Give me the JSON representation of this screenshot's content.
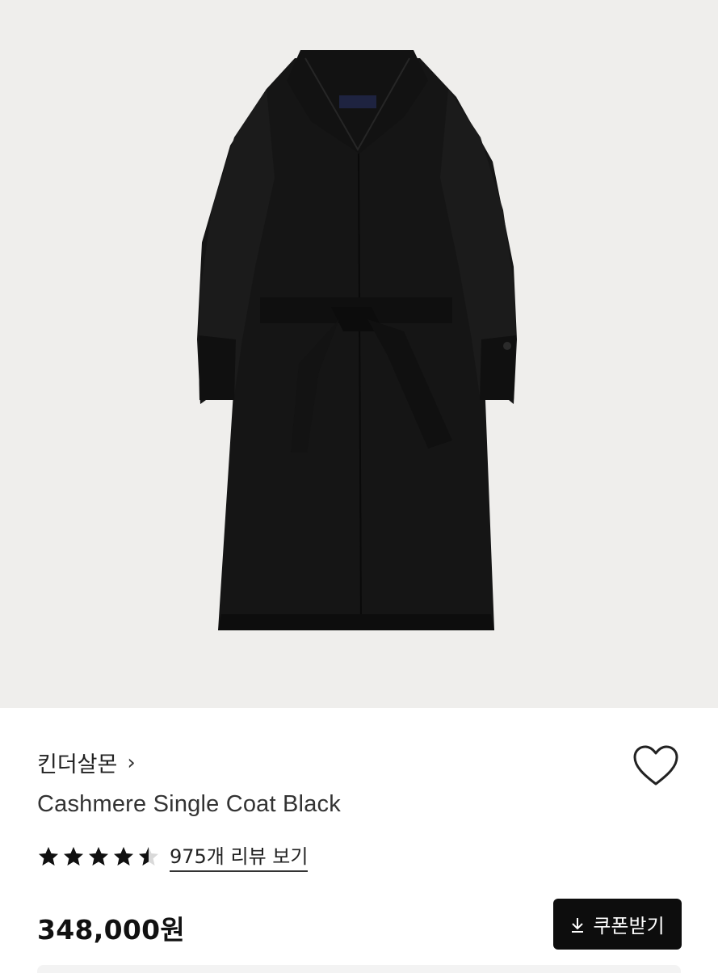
{
  "product": {
    "image_alt": "Cashmere Single Coat Black product image",
    "brand": "킨더살몬",
    "brand_chevron": "›",
    "title": "Cashmere Single Coat Black",
    "rating": 4.5,
    "rating_max": 5,
    "review_link": "975개 리뷰 보기",
    "price": "348,000원",
    "coupon_button": "쿠폰받기"
  },
  "icons": {
    "wishlist": "heart-outline-icon",
    "coupon": "download-icon",
    "star": "star-icon"
  },
  "colors": {
    "hero_bg": "#efeeec",
    "coat": "#141414",
    "button_bg": "#0d0d0d",
    "star": "#111111"
  }
}
